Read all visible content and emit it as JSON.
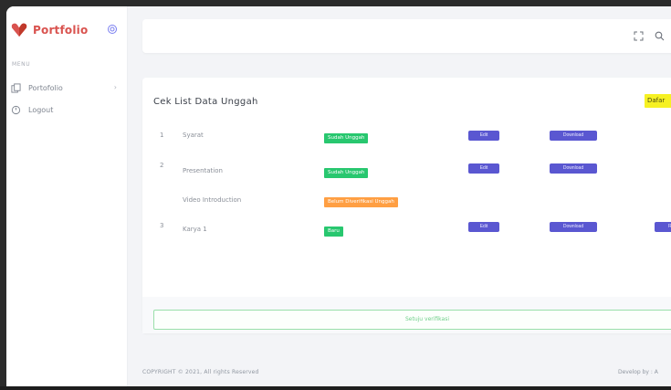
{
  "brand": {
    "name": "Portfolio",
    "color": "#d9534f"
  },
  "sidebar": {
    "section_label": "MENU",
    "items": [
      {
        "label": "Portofolio",
        "icon": "copy-icon",
        "chevron": "›"
      },
      {
        "label": "Logout",
        "icon": "logout-icon"
      }
    ]
  },
  "topbar": {
    "icons": [
      "fullscreen-icon",
      "search-icon"
    ]
  },
  "card": {
    "title": "Cek List Data Unggah",
    "badge": "Dafar",
    "rows": [
      {
        "num": "1",
        "name": "Syarat",
        "status": "Sudah Unggah",
        "status_color": "#28c76f",
        "edit": "Edit",
        "download": "Download"
      },
      {
        "num": "2",
        "name": "Presentation",
        "status": "Sudah Unggah",
        "status_color": "#28c76f",
        "edit": "Edit",
        "download": "Download"
      },
      {
        "num": "",
        "name": "Video Introduction",
        "status": "Belum Diverifikasi Unggah",
        "status_color": "#ff9f43"
      },
      {
        "num": "3",
        "name": "Karya 1",
        "status": "Baru",
        "status_color": "#28c76f",
        "edit": "Edit",
        "download": "Download",
        "extra": "Revi"
      }
    ],
    "verify_label": "Setuju verifikasi"
  },
  "footer": {
    "copyright": "COPYRIGHT © 2021, All rights Reserved",
    "credit": "Develop by : A"
  },
  "colors": {
    "accent": "#5a57d1",
    "success": "#28c76f",
    "warning": "#ff9f43",
    "highlight": "#f6f123"
  }
}
